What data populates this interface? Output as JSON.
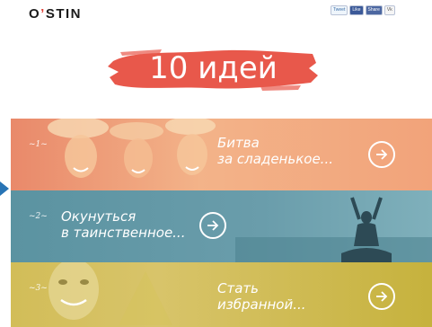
{
  "header": {
    "logo_left": "O",
    "logo_apos": "’",
    "logo_right": "STIN",
    "share": [
      "Tweet",
      "Like",
      "Share",
      "Vk"
    ]
  },
  "title": "10 идей",
  "ideas": [
    {
      "number": "~1~",
      "line1": "Битва",
      "line2": "за сладенькое...",
      "color": "#f0a175"
    },
    {
      "number": "~2~",
      "line1": "Окунуться",
      "line2": "в таинственное...",
      "color": "#5d97a5"
    },
    {
      "number": "~3~",
      "line1": "Стать",
      "line2": "избранной...",
      "color": "#c9b540"
    }
  ],
  "colors": {
    "title_brush": "#e8584b",
    "marker": "#2874b5"
  }
}
